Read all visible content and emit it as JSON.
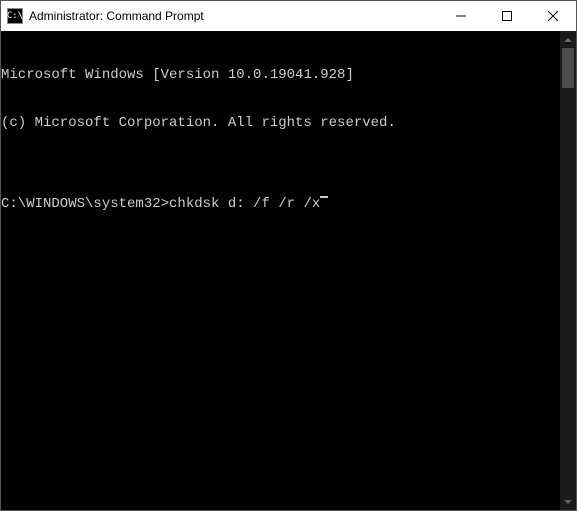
{
  "titlebar": {
    "icon_text": "C:\\",
    "title": "Administrator: Command Prompt"
  },
  "terminal": {
    "line1": "Microsoft Windows [Version 10.0.19041.928]",
    "line2": "(c) Microsoft Corporation. All rights reserved.",
    "blank": "",
    "prompt": "C:\\WINDOWS\\system32>",
    "command": "chkdsk d: /f /r /x"
  }
}
